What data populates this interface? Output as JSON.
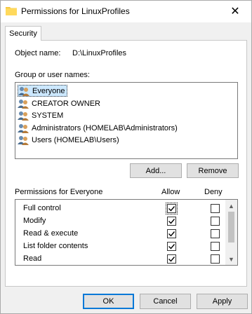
{
  "window": {
    "title": "Permissions for LinuxProfiles",
    "close_glyph": "✕",
    "folder_icon": "folder-icon"
  },
  "tabs": [
    {
      "label": "Security",
      "active": true
    }
  ],
  "object": {
    "label": "Object name:",
    "value": "D:\\LinuxProfiles"
  },
  "groups": {
    "label": "Group or user names:",
    "items": [
      {
        "label": "Everyone",
        "selected": true
      },
      {
        "label": "CREATOR OWNER",
        "selected": false
      },
      {
        "label": "SYSTEM",
        "selected": false
      },
      {
        "label": "Administrators (HOMELAB\\Administrators)",
        "selected": false
      },
      {
        "label": "Users (HOMELAB\\Users)",
        "selected": false
      }
    ]
  },
  "group_buttons": {
    "add": "Add...",
    "remove": "Remove"
  },
  "permissions": {
    "header": "Permissions for Everyone",
    "allow_header": "Allow",
    "deny_header": "Deny",
    "rows": [
      {
        "name": "Full control",
        "allow": true,
        "deny": false
      },
      {
        "name": "Modify",
        "allow": true,
        "deny": false
      },
      {
        "name": "Read & execute",
        "allow": true,
        "deny": false
      },
      {
        "name": "List folder contents",
        "allow": true,
        "deny": false
      },
      {
        "name": "Read",
        "allow": true,
        "deny": false
      },
      {
        "name": "",
        "allow": true,
        "deny": false
      }
    ]
  },
  "footer_buttons": {
    "ok": "OK",
    "cancel": "Cancel",
    "apply": "Apply"
  },
  "colors": {
    "accent": "#0078d7",
    "selection": "#cce8ff",
    "check": "#000000"
  }
}
